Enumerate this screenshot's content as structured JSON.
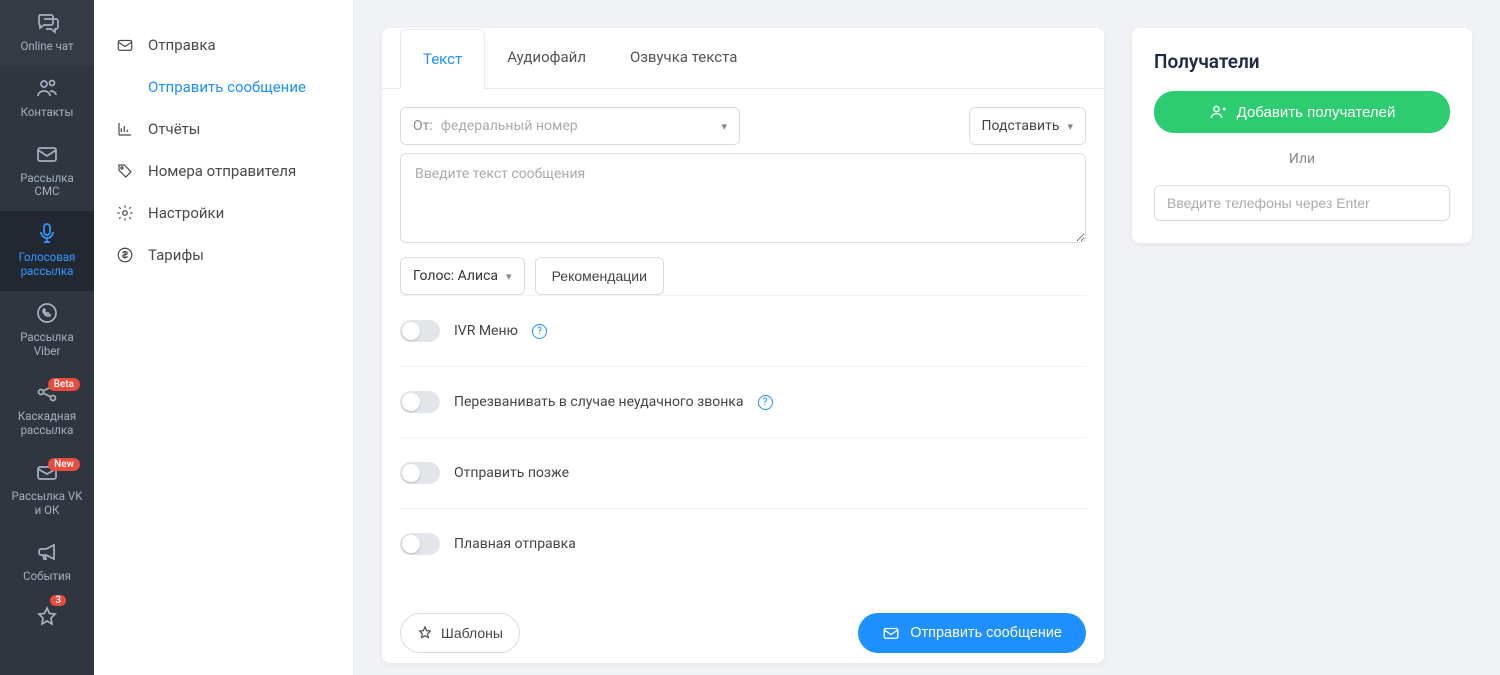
{
  "mainNav": [
    {
      "key": "online-chat",
      "label": "Online чат"
    },
    {
      "key": "contacts",
      "label": "Контакты"
    },
    {
      "key": "sms",
      "label": "Рассылка\nСМС"
    },
    {
      "key": "voice",
      "label": "Голосовая\nрассылка",
      "active": true
    },
    {
      "key": "viber",
      "label": "Рассылка\nViber"
    },
    {
      "key": "cascade",
      "label": "Каскадная\nрассылка",
      "badge": "Beta"
    },
    {
      "key": "vk-ok",
      "label": "Рассылка VK\nи ОК",
      "badge": "New"
    },
    {
      "key": "events",
      "label": "События"
    },
    {
      "key": "fav",
      "label": "",
      "badge": "3"
    }
  ],
  "subNav": [
    {
      "key": "send",
      "label": "Отправка"
    },
    {
      "key": "send-msg",
      "label": "Отправить сообщение",
      "active": true,
      "sub": true
    },
    {
      "key": "reports",
      "label": "Отчёты"
    },
    {
      "key": "sender-nums",
      "label": "Номера отправителя"
    },
    {
      "key": "settings",
      "label": "Настройки"
    },
    {
      "key": "tariffs",
      "label": "Тарифы"
    }
  ],
  "tabs": [
    {
      "key": "text",
      "label": "Текст",
      "active": true
    },
    {
      "key": "audio",
      "label": "Аудиофайл"
    },
    {
      "key": "tts",
      "label": "Озвучка текста"
    }
  ],
  "form": {
    "fromPrefix": "От:",
    "fromPlaceholder": "федеральный номер",
    "substitute": "Подставить",
    "msgPlaceholder": "Введите текст сообщения",
    "voice": "Голос: Алиса",
    "recs": "Рекомендации"
  },
  "toggles": {
    "ivr": "IVR Меню",
    "callback": "Перезванивать в случае неудачного звонка",
    "later": "Отправить позже",
    "smooth": "Плавная отправка"
  },
  "footer": {
    "templates": "Шаблоны",
    "send": "Отправить сообщение"
  },
  "recipients": {
    "title": "Получатели",
    "add": "Добавить получателей",
    "or": "Или",
    "phonesPlaceholder": "Введите телефоны через Enter"
  }
}
